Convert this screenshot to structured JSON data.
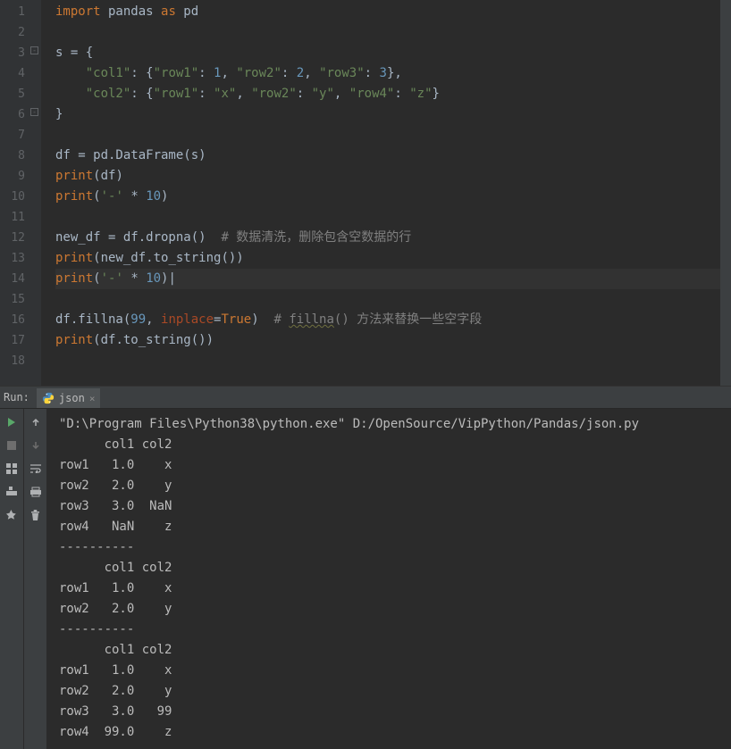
{
  "editor": {
    "lines": [
      {
        "n": "1",
        "html": "<span class='kw'>import</span> pandas <span class='kw'>as</span> pd"
      },
      {
        "n": "2",
        "html": ""
      },
      {
        "n": "3",
        "html": "s = {",
        "fold": "-"
      },
      {
        "n": "4",
        "html": "    <span class='str'>\"col1\"</span>: {<span class='str'>\"row1\"</span>: <span class='num'>1</span>, <span class='str'>\"row2\"</span>: <span class='num'>2</span>, <span class='str'>\"row3\"</span>: <span class='num'>3</span>},"
      },
      {
        "n": "5",
        "html": "    <span class='str'>\"col2\"</span>: {<span class='str'>\"row1\"</span>: <span class='str'>\"x\"</span>, <span class='str'>\"row2\"</span>: <span class='str'>\"y\"</span>, <span class='str'>\"row4\"</span>: <span class='str'>\"z\"</span>}"
      },
      {
        "n": "6",
        "html": "}",
        "fold": "-"
      },
      {
        "n": "7",
        "html": ""
      },
      {
        "n": "8",
        "html": "df = pd.DataFrame(s)"
      },
      {
        "n": "9",
        "html": "<span class='kw'>print</span>(df)"
      },
      {
        "n": "10",
        "html": "<span class='kw'>print</span>(<span class='str'>'-'</span> * <span class='num'>10</span>)"
      },
      {
        "n": "11",
        "html": ""
      },
      {
        "n": "12",
        "html": "new_df = df.dropna()  <span class='comment'># 数据清洗，删除包含空数据的行</span>"
      },
      {
        "n": "13",
        "html": "<span class='kw'>print</span>(new_df.to_string())"
      },
      {
        "n": "14",
        "html": "<span class='kw'>print</span>(<span class='str'>'-'</span> * <span class='num'>10</span>)<span class='caret'>|</span>",
        "current": true
      },
      {
        "n": "15",
        "html": ""
      },
      {
        "n": "16",
        "html": "df.fillna(<span class='num'>99</span>, <span class='param'>inplace</span>=<span class='kw'>True</span>)  <span class='comment'># <span class='warn'>fillna</span>() 方法来替换一些空字段</span>"
      },
      {
        "n": "17",
        "html": "<span class='kw'>print</span>(df.to_string())"
      },
      {
        "n": "18",
        "html": ""
      }
    ]
  },
  "run": {
    "label": "Run:",
    "tab_name": "json"
  },
  "console": {
    "lines": [
      "\"D:\\Program Files\\Python38\\python.exe\" D:/OpenSource/VipPython/Pandas/json.py",
      "      col1 col2",
      "row1   1.0    x",
      "row2   2.0    y",
      "row3   3.0  NaN",
      "row4   NaN    z",
      "----------",
      "      col1 col2",
      "row1   1.0    x",
      "row2   2.0    y",
      "----------",
      "      col1 col2",
      "row1   1.0    x",
      "row2   2.0    y",
      "row3   3.0   99",
      "row4  99.0    z"
    ]
  }
}
